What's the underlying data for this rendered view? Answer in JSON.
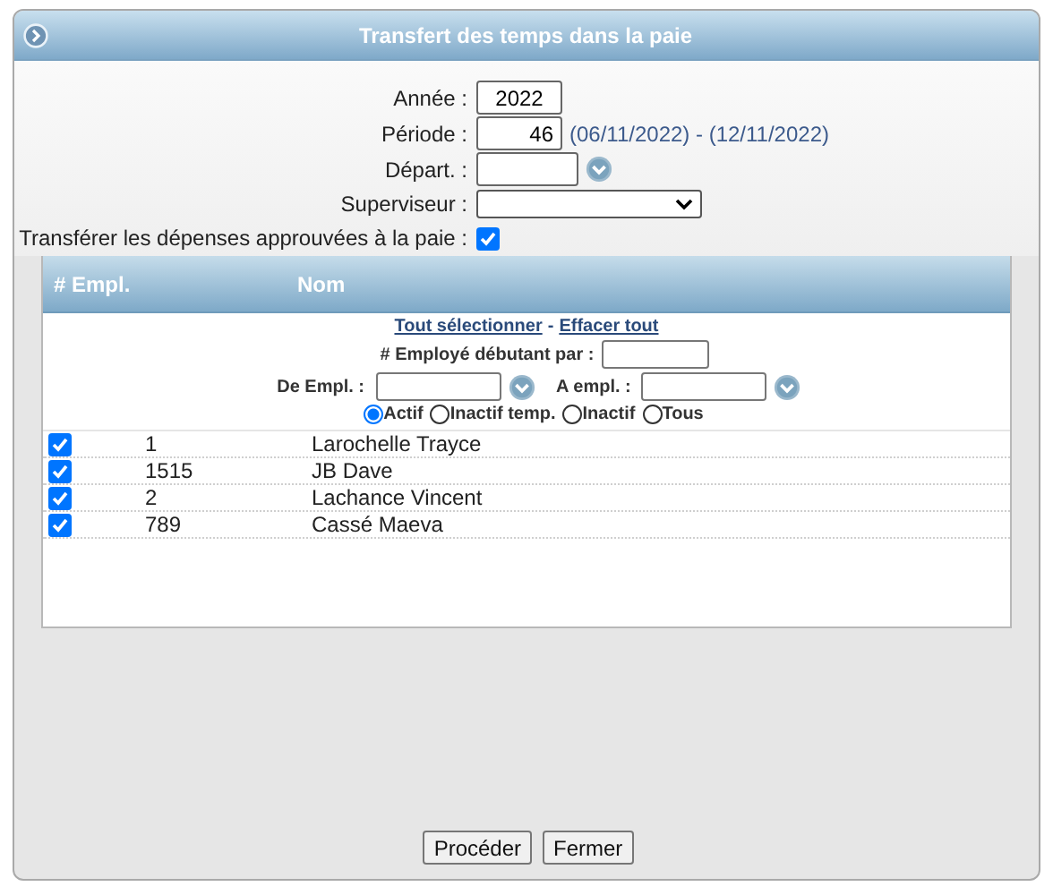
{
  "window": {
    "title": "Transfert des temps dans la paie"
  },
  "form": {
    "fields": [
      {
        "kind": "text",
        "label": "Année :",
        "value": "2022"
      },
      {
        "kind": "text",
        "label": "Période :",
        "value": "46",
        "note": "(06/11/2022) - (12/11/2022)"
      },
      {
        "kind": "lookup",
        "label": "Départ. :"
      },
      {
        "kind": "select",
        "label": "Superviseur :"
      },
      {
        "kind": "checkbox",
        "label": "Transférer les dépenses approuvées à la paie :",
        "checked": true
      }
    ]
  },
  "employees": {
    "columns": [
      "# Empl.",
      "Nom"
    ],
    "links": [
      "Tout sélectionner",
      "Effacer tout"
    ],
    "separator": "-",
    "prefix_filter": {
      "label": "# Employé débutant par :"
    },
    "range": [
      {
        "label": "De Empl. :"
      },
      {
        "label": "A empl. :"
      }
    ],
    "status_options": [
      {
        "label": "Actif",
        "selected": true
      },
      {
        "label": "Inactif temp.",
        "selected": false
      },
      {
        "label": "Inactif",
        "selected": false
      },
      {
        "label": "Tous",
        "selected": false
      }
    ],
    "rows": [
      {
        "checked": true,
        "number": "1",
        "name": "Larochelle Trayce"
      },
      {
        "checked": true,
        "number": "1515",
        "name": "JB Dave"
      },
      {
        "checked": true,
        "number": "2",
        "name": "Lachance Vincent"
      },
      {
        "checked": true,
        "number": "789",
        "name": "Cassé Maeva"
      }
    ]
  },
  "buttons": [
    "Procéder",
    "Fermer"
  ]
}
